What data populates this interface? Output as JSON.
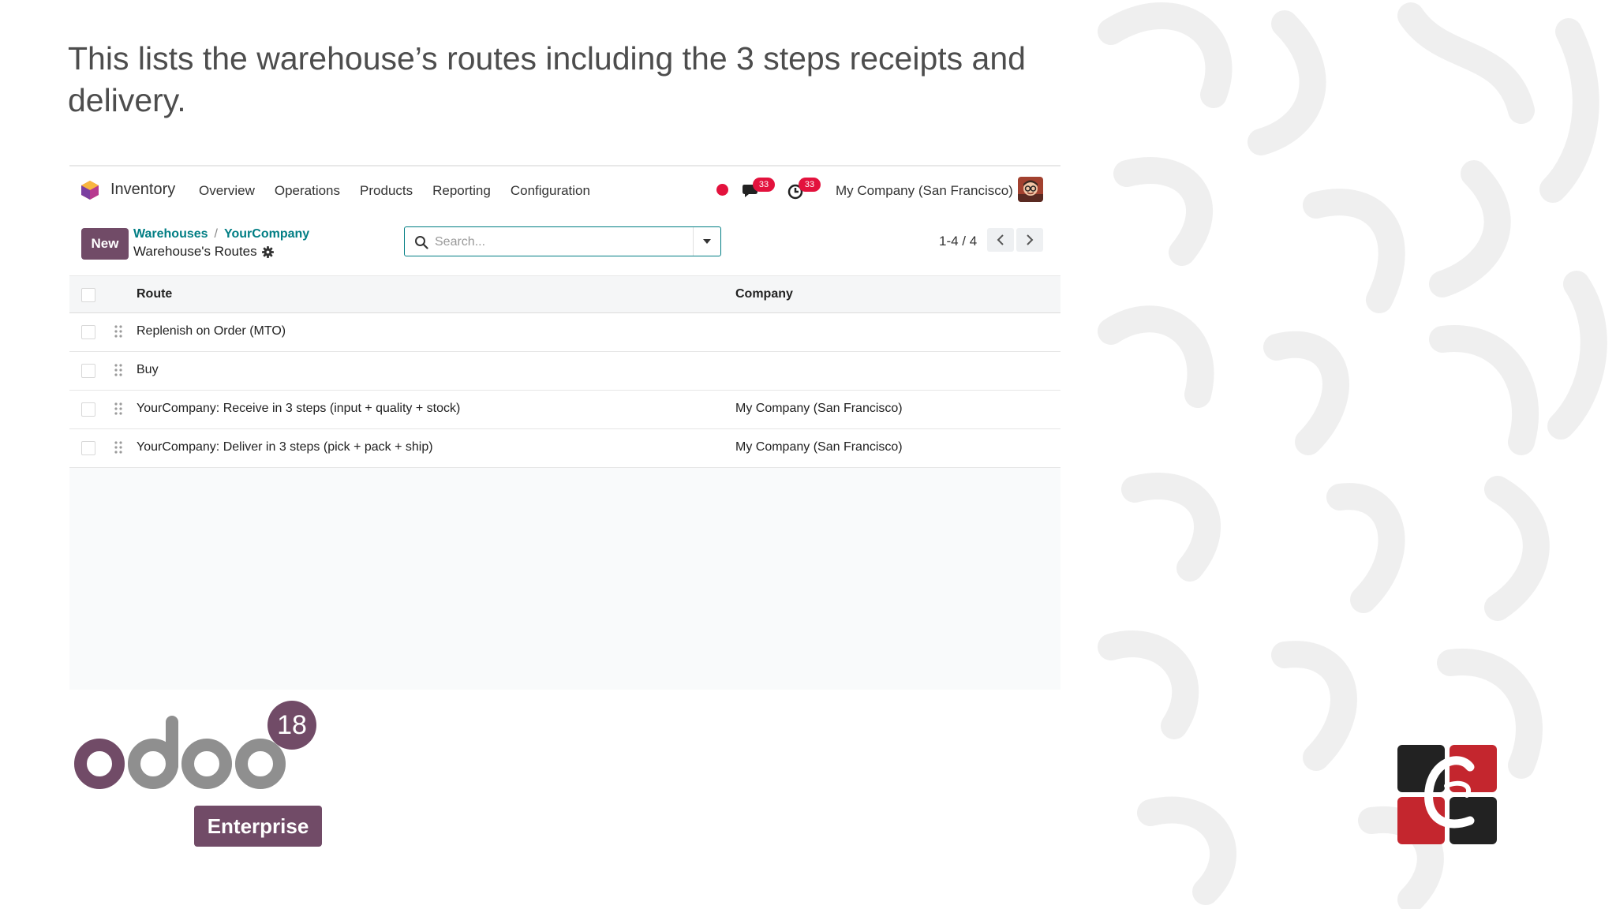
{
  "slide": {
    "title": "This lists the warehouse’s routes including the 3 steps receipts and delivery."
  },
  "navbar": {
    "app_name": "Inventory",
    "menu": [
      "Overview",
      "Operations",
      "Products",
      "Reporting",
      "Configuration"
    ],
    "messages_count": "33",
    "activities_count": "33",
    "company": "My Company (San Francisco)"
  },
  "controlbar": {
    "new_label": "New",
    "breadcrumb": [
      "Warehouses",
      "YourCompany"
    ],
    "breadcrumb_sep": "/",
    "current_page": "Warehouse's Routes",
    "search_placeholder": "Search...",
    "pager": "1-4 / 4"
  },
  "table": {
    "columns": [
      "Route",
      "Company"
    ],
    "rows": [
      {
        "route": "Replenish on Order (MTO)",
        "company": ""
      },
      {
        "route": "Buy",
        "company": ""
      },
      {
        "route": "YourCompany: Receive in 3 steps (input + quality + stock)",
        "company": "My Company (San Francisco)"
      },
      {
        "route": "YourCompany: Deliver in 3 steps (pick + pack + ship)",
        "company": "My Company (San Francisco)"
      }
    ]
  },
  "branding": {
    "version": "18",
    "edition": "Enterprise",
    "logo_word": "odoo",
    "brand_color": "#714b67",
    "accent_color": "#017e84",
    "badge_color": "#e3123d"
  },
  "icons": {
    "search": "search-icon",
    "gear": "gear-icon",
    "chat": "chat-icon",
    "clock": "clock-icon",
    "caret": "caret-down-icon",
    "prev": "chevron-left-icon",
    "next": "chevron-right-icon",
    "drag": "drag-handle-icon"
  }
}
